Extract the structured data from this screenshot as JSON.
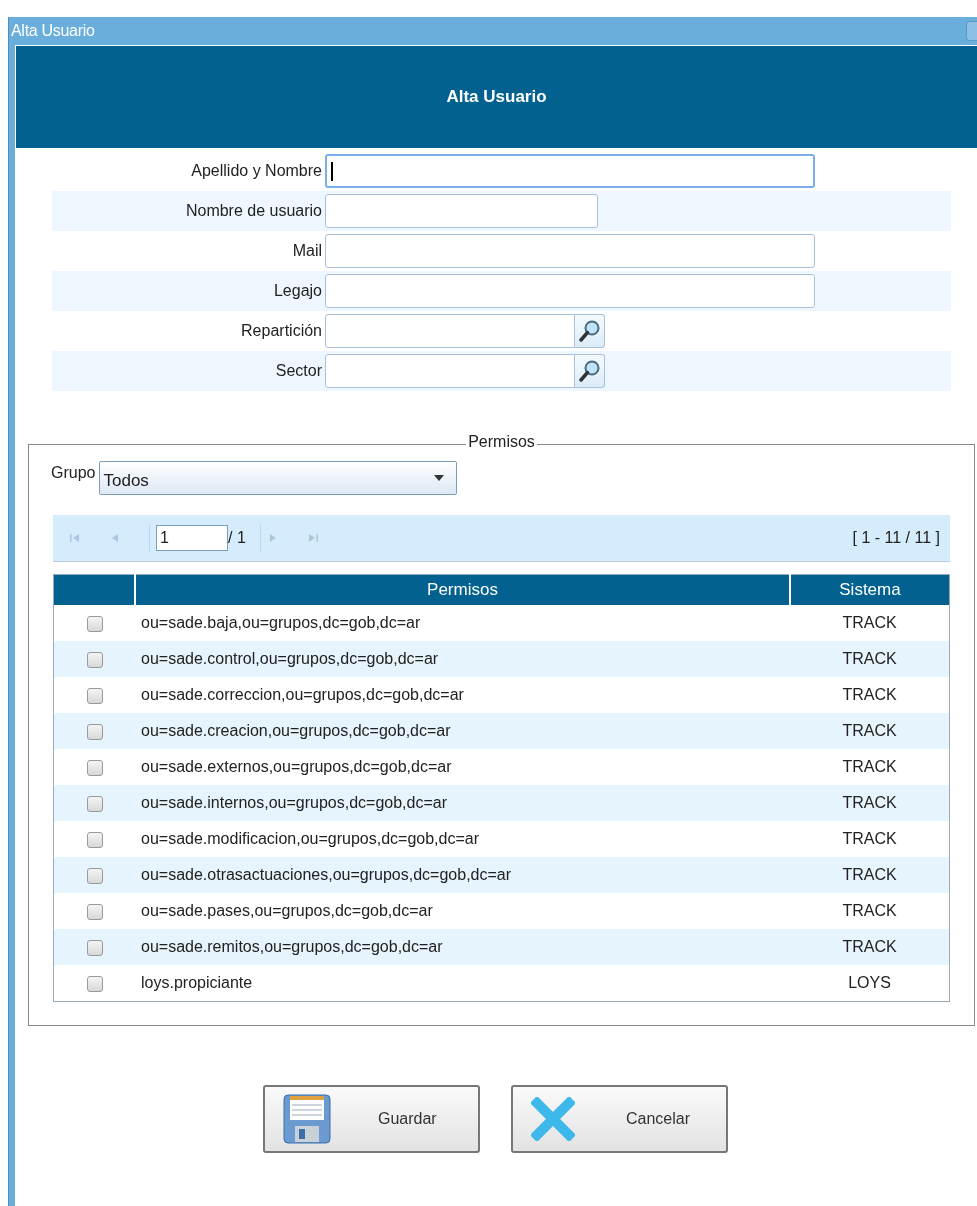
{
  "window": {
    "title": "Alta Usuario"
  },
  "header": {
    "title": "Alta Usuario"
  },
  "fields": [
    {
      "label": "Apellido y Nombre",
      "kind": "text",
      "focused": true
    },
    {
      "label": "Nombre de usuario",
      "kind": "short",
      "focused": false
    },
    {
      "label": "Mail",
      "kind": "text",
      "focused": false
    },
    {
      "label": "Legajo",
      "kind": "text",
      "focused": false
    },
    {
      "label": "Repartición",
      "kind": "lookup",
      "focused": false
    },
    {
      "label": "Sector",
      "kind": "lookup",
      "focused": false
    }
  ],
  "permisos": {
    "legend": "Permisos",
    "group": {
      "label": "Grupo",
      "value": "Todos"
    },
    "pager": {
      "page": "1",
      "total": "/ 1",
      "range": "[ 1 - 11 / 11 ]"
    },
    "table": {
      "columns": [
        "Permisos",
        "Sistema"
      ],
      "rows": [
        {
          "checked": false,
          "permiso": "ou=sade.baja,ou=grupos,dc=gob,dc=ar",
          "sistema": "TRACK"
        },
        {
          "checked": false,
          "permiso": "ou=sade.control,ou=grupos,dc=gob,dc=ar",
          "sistema": "TRACK"
        },
        {
          "checked": false,
          "permiso": "ou=sade.correccion,ou=grupos,dc=gob,dc=ar",
          "sistema": "TRACK"
        },
        {
          "checked": false,
          "permiso": "ou=sade.creacion,ou=grupos,dc=gob,dc=ar",
          "sistema": "TRACK"
        },
        {
          "checked": false,
          "permiso": "ou=sade.externos,ou=grupos,dc=gob,dc=ar",
          "sistema": "TRACK"
        },
        {
          "checked": false,
          "permiso": "ou=sade.internos,ou=grupos,dc=gob,dc=ar",
          "sistema": "TRACK"
        },
        {
          "checked": false,
          "permiso": "ou=sade.modificacion,ou=grupos,dc=gob,dc=ar",
          "sistema": "TRACK"
        },
        {
          "checked": false,
          "permiso": "ou=sade.otrasactuaciones,ou=grupos,dc=gob,dc=ar",
          "sistema": "TRACK"
        },
        {
          "checked": false,
          "permiso": "ou=sade.pases,ou=grupos,dc=gob,dc=ar",
          "sistema": "TRACK"
        },
        {
          "checked": false,
          "permiso": "ou=sade.remitos,ou=grupos,dc=gob,dc=ar",
          "sistema": "TRACK"
        },
        {
          "checked": false,
          "permiso": "loys.propiciante",
          "sistema": "LOYS"
        }
      ]
    }
  },
  "buttons": [
    {
      "label": "Guardar",
      "kind": "save"
    },
    {
      "label": "Cancelar",
      "kind": "cancel"
    }
  ]
}
